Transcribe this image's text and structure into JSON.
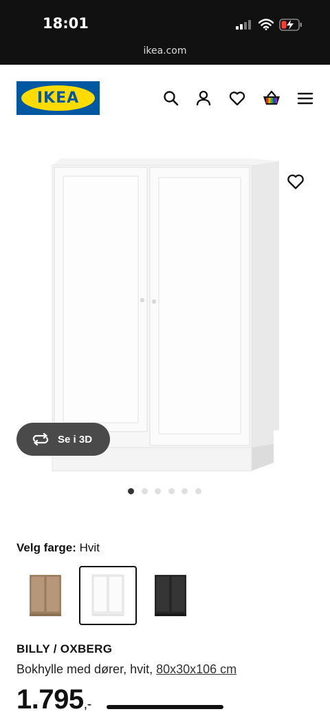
{
  "status_bar": {
    "time": "18:01",
    "url": "ikea.com"
  },
  "header": {
    "logo_text": "IKEA",
    "icons": [
      "search-icon",
      "profile-icon",
      "heart-icon",
      "basket-icon",
      "menu-icon"
    ]
  },
  "gallery": {
    "view_3d_label": "Se i 3D",
    "image_count": 6,
    "active_index": 0
  },
  "color": {
    "label": "Velg farge:",
    "value": "Hvit",
    "swatches": [
      "walnut",
      "white",
      "black"
    ],
    "selected_index": 1
  },
  "product": {
    "name": "BILLY / OXBERG",
    "description": "Bokhylle med dører, hvit, ",
    "dimensions": "80x30x106 cm",
    "price": "1.795",
    "price_suffix": ",-"
  },
  "colors": {
    "ikea_blue": "#0058a3",
    "ikea_yellow": "#ffdb00"
  }
}
